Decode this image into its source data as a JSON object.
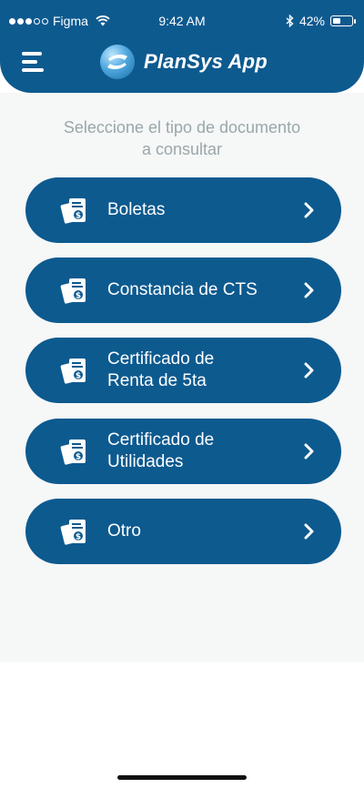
{
  "status_bar": {
    "carrier": "Figma",
    "time": "9:42 AM",
    "battery_percent": "42%",
    "battery_level": 0.42,
    "signal_bars_filled": 3,
    "signal_bars_total": 5
  },
  "header": {
    "app_title": "PlanSys App",
    "background_color": "#0d5a8f"
  },
  "prompt": {
    "line1": "Seleccione el tipo de documento",
    "line2": "a consultar"
  },
  "documents": [
    {
      "line1": "Boletas",
      "line2": ""
    },
    {
      "line1": "Constancia de CTS",
      "line2": ""
    },
    {
      "line1": "Certificado de",
      "line2": "Renta de 5ta"
    },
    {
      "line1": "Certificado de",
      "line2": "Utilidades"
    },
    {
      "line1": "Otro",
      "line2": ""
    }
  ],
  "icons": {
    "menu": "hamburger-menu-icon",
    "logo": "plansys-logo-icon",
    "document": "receipt-dollar-icon",
    "chevron": "chevron-right-icon",
    "wifi": "wifi-icon",
    "bluetooth": "bluetooth-icon",
    "battery": "battery-icon"
  }
}
